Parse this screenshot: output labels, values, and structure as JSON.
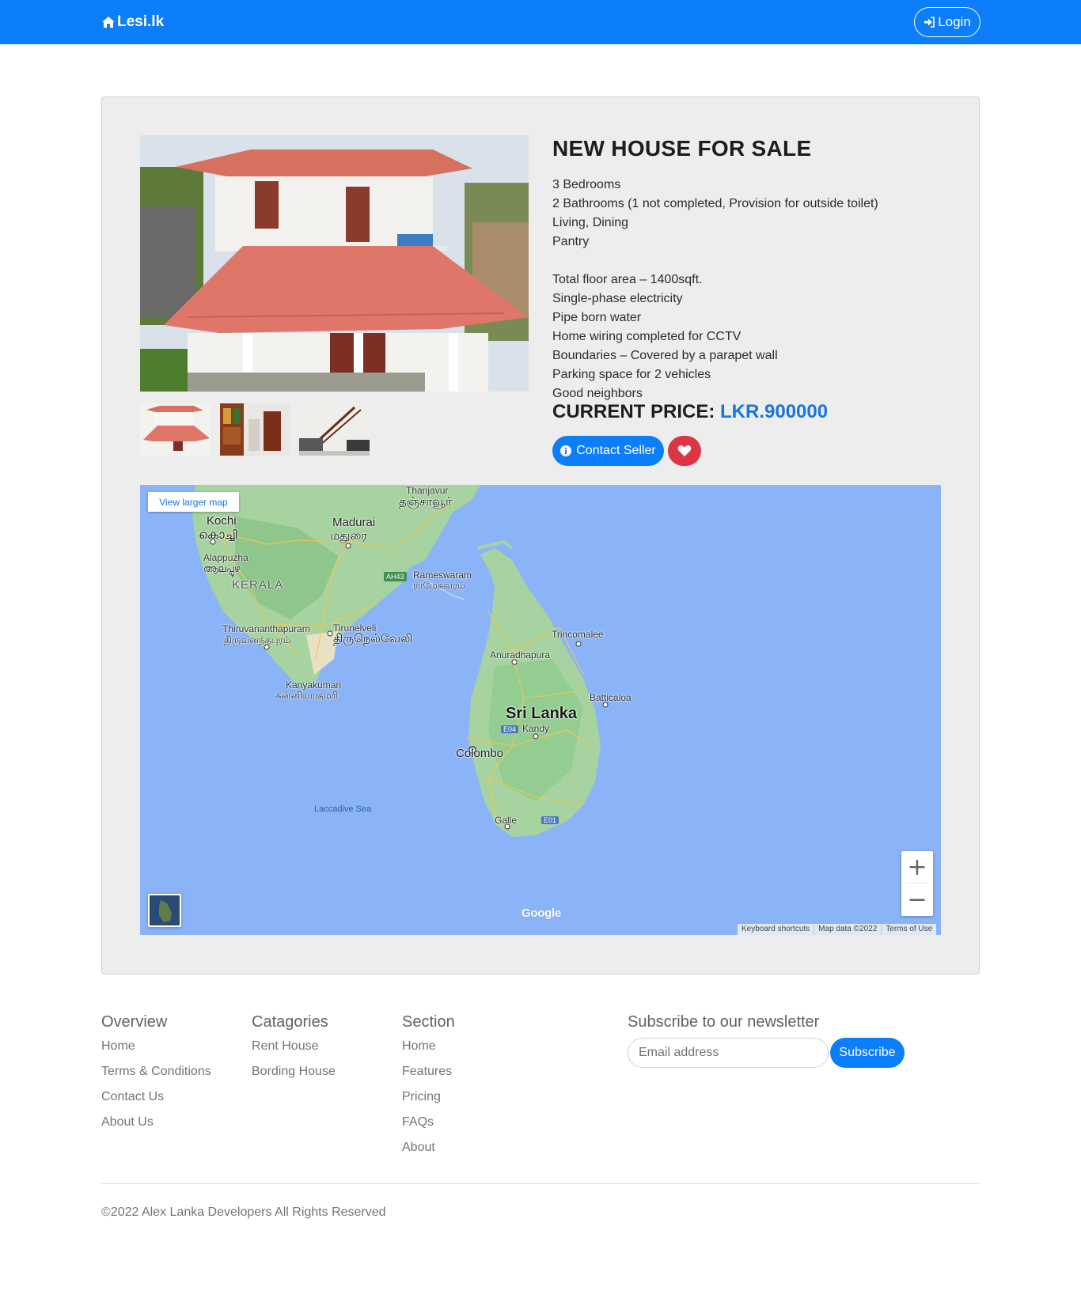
{
  "navbar": {
    "brand": "Lesi.lk",
    "login_label": "Login"
  },
  "listing": {
    "title": "NEW HOUSE FOR SALE",
    "description_lines": [
      "3 Bedrooms",
      "2 Bathrooms (1 not completed, Provision for outside toilet)",
      "Living, Dining",
      "Pantry",
      "",
      "Total floor area – 1400sqft.",
      "Single-phase electricity",
      "Pipe born water",
      "Home wiring completed for CCTV",
      "Boundaries – Covered by a parapet wall",
      "Parking space for 2 vehicles",
      "Good neighbors"
    ],
    "price_label": "CURRENT PRICE:",
    "price_value": "LKR.900000",
    "contact_label": "Contact Seller"
  },
  "map": {
    "view_larger": "View larger map",
    "zoom_in": "+",
    "zoom_out": "−",
    "google": "Google",
    "footer": {
      "shortcuts": "Keyboard shortcuts",
      "data": "Map data ©2022",
      "terms": "Terms of Use"
    },
    "labels": {
      "thanjavur": "Thanjavur",
      "thanjavur_ta": "தஞ்சாவூர்",
      "kochi": "Kochi",
      "kochi_ml": "കൊച്ചി",
      "madurai": "Madurai",
      "madurai_ta": "மதுரை",
      "alappuzha": "Alappuzha",
      "alappuzha_ml": "ആലപ്പുഴ",
      "kerala": "KERALA",
      "ah43": "AH43",
      "rameswaram": "Rameswaram",
      "rameswaram_ta": "ராமேசுவரம்",
      "thiruvananthapuram": "Thiruvananthapuram",
      "thiruvananthapuram_ta": "திருவனந்தபுரம்",
      "tirunelveli": "Tirunelveli",
      "tirunelveli_ta": "திருநெல்வேலி",
      "kanyakumari": "Kanyakumari",
      "kanyakumari_ta": "கன்னியாகுமரி",
      "trincomalee": "Trincomalee",
      "anuradhapura": "Anuradhapura",
      "batticaloa": "Batticaloa",
      "sri_lanka": "Sri Lanka",
      "e04": "E04",
      "kandy": "Kandy",
      "colombo": "Colombo",
      "laccadive_sea": "Laccadive Sea",
      "galle": "Galle",
      "e01": "E01"
    }
  },
  "footer": {
    "overview": {
      "heading": "Overview",
      "links": [
        "Home",
        "Terms & Conditions",
        "Contact Us",
        "About Us"
      ]
    },
    "categories": {
      "heading": "Catagories",
      "links": [
        "Rent House",
        "Bording House"
      ]
    },
    "section": {
      "heading": "Section",
      "links": [
        "Home",
        "Features",
        "Pricing",
        "FAQs",
        "About"
      ]
    },
    "newsletter": {
      "heading": "Subscribe to our newsletter",
      "email_placeholder": "Email address",
      "subscribe_label": "Subscribe"
    },
    "copyright": "©2022 Alex Lanka Developers All Rights Reserved"
  }
}
